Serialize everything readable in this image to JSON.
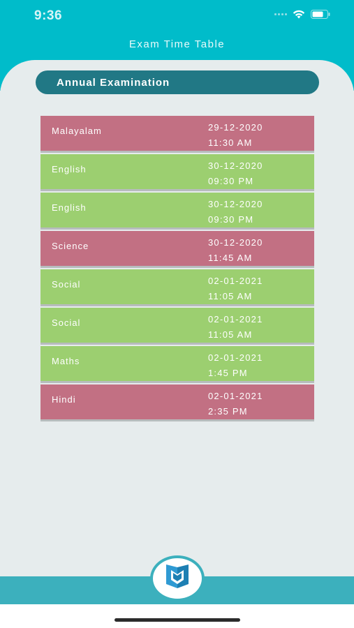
{
  "status_bar": {
    "time": "9:36"
  },
  "header": {
    "title": "Exam Time Table"
  },
  "section": {
    "title": "Annual Examination"
  },
  "exams": [
    {
      "subject": "Malayalam",
      "date": "29-12-2020",
      "time": "11:30 AM",
      "color": "red"
    },
    {
      "subject": "English",
      "date": "30-12-2020",
      "time": "09:30 PM",
      "color": "green"
    },
    {
      "subject": "English",
      "date": "30-12-2020",
      "time": "09:30 PM",
      "color": "green"
    },
    {
      "subject": "Science",
      "date": "30-12-2020",
      "time": "11:45 AM",
      "color": "red"
    },
    {
      "subject": "Social",
      "date": "02-01-2021",
      "time": "11:05 AM",
      "color": "green"
    },
    {
      "subject": "Social",
      "date": "02-01-2021",
      "time": "11:05 AM",
      "color": "green"
    },
    {
      "subject": "Maths",
      "date": "02-01-2021",
      "time": "1:45 PM",
      "color": "green"
    },
    {
      "subject": "Hindi",
      "date": "02-01-2021",
      "time": "2:35 PM",
      "color": "red"
    }
  ],
  "colors": {
    "accent": "#00bcca",
    "pill": "#217885",
    "row_red": "#c27083",
    "row_green": "#9ccf70",
    "bottom_bar": "#3cb0bd"
  },
  "icons": {
    "wifi": "wifi-icon",
    "battery": "battery-icon",
    "logo": "book-logo-icon"
  }
}
